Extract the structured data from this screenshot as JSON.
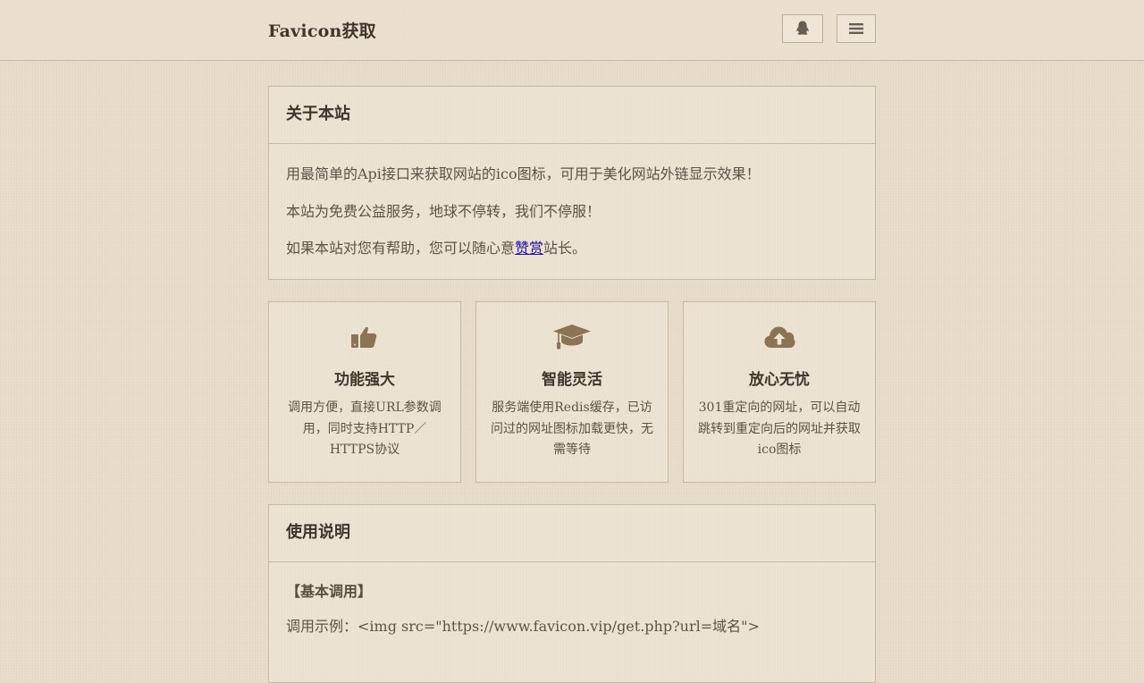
{
  "header": {
    "brand": "Favicon获取",
    "qq_icon": "qq-penguin-icon",
    "menu_icon": "hamburger-menu-icon"
  },
  "about": {
    "title": "关于本站",
    "line1": "用最简单的Api接口来获取网站的ico图标，可用于美化网站外链显示效果！",
    "line2": "本站为免费公益服务，地球不停转，我们不停服！",
    "line3_prefix": "如果本站对您有帮助，您可以随心意",
    "line3_link": "赞赏",
    "line3_suffix": "站长。"
  },
  "features": [
    {
      "icon": "thumbs-up-icon",
      "title": "功能强大",
      "desc": "调用方便，直接URL参数调用，同时支持HTTP／HTTPS协议"
    },
    {
      "icon": "graduation-cap-icon",
      "title": "智能灵活",
      "desc": "服务端使用Redis缓存，已访问过的网址图标加载更快，无需等待"
    },
    {
      "icon": "cloud-upload-icon",
      "title": "放心无忧",
      "desc": "301重定向的网址，可以自动跳转到重定向后的网址并获取ico图标"
    }
  ],
  "usage": {
    "title": "使用说明",
    "subtitle": "【基本调用】",
    "example": "调用示例：<img src=\"https://www.favicon.vip/get.php?url=域名\">"
  },
  "colors": {
    "background": "#e7dcc9",
    "icon": "#8b7355",
    "text": "#5e5247",
    "heading": "#3f352c",
    "border": "#c9b9a2",
    "link": "#1a0dab"
  }
}
